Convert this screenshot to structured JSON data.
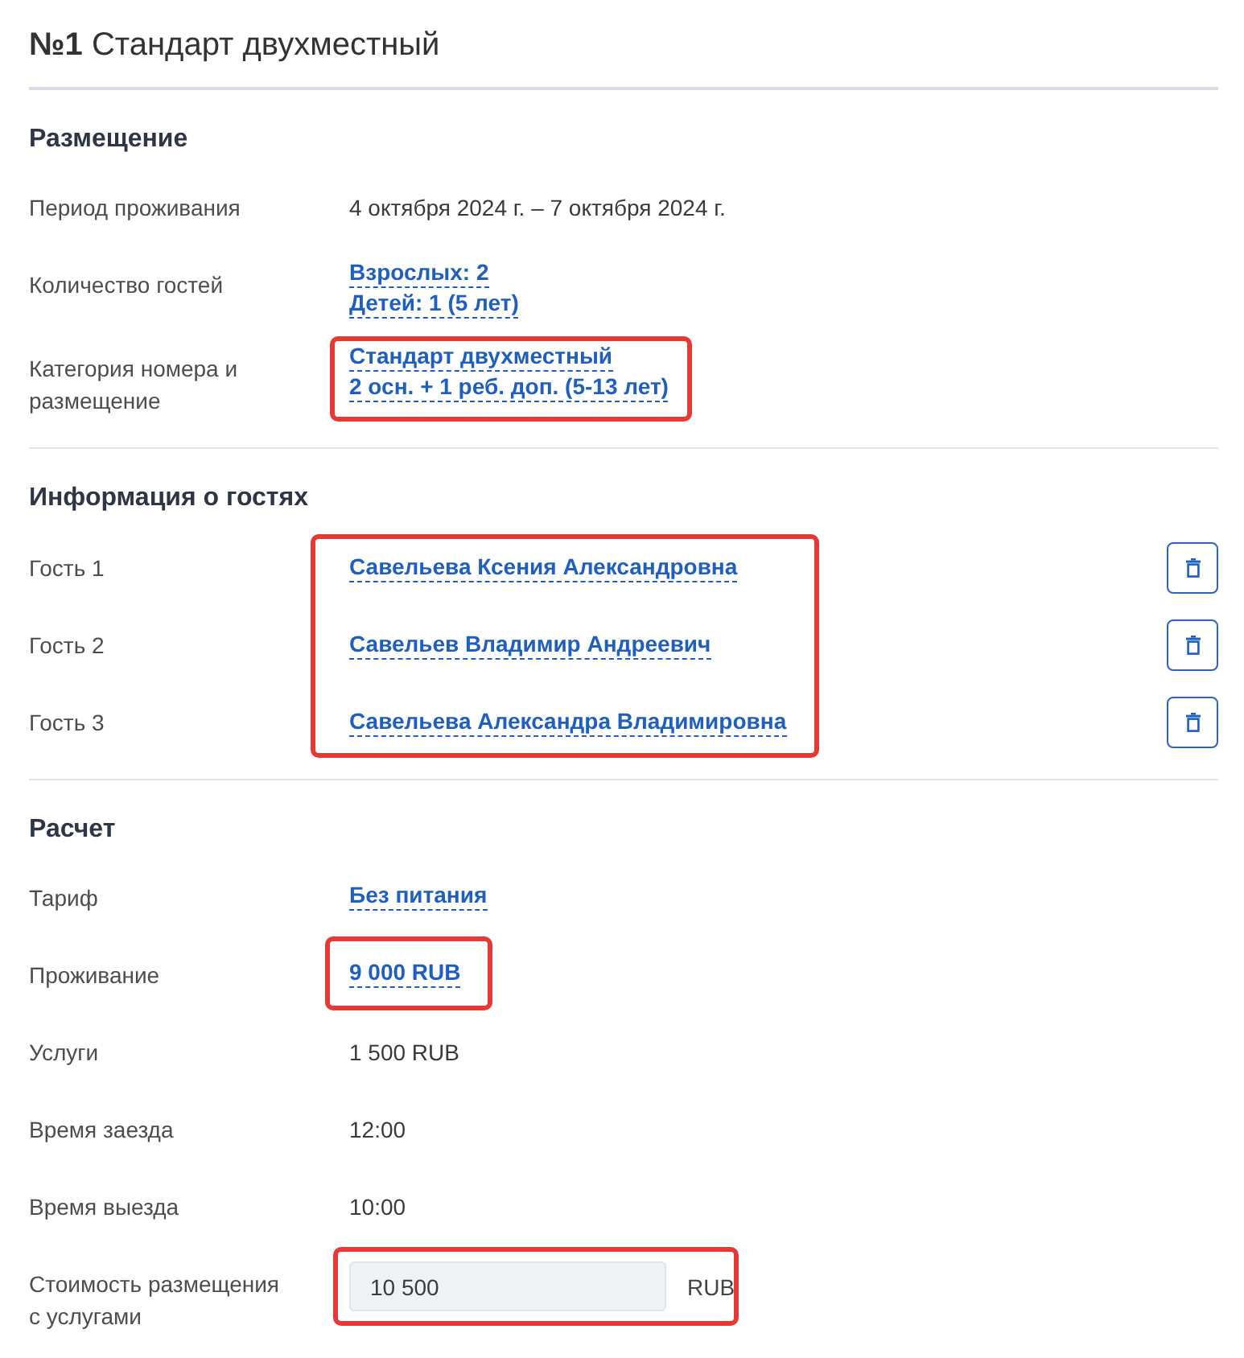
{
  "title": "**№1** Стандарт двухместный",
  "sections": [
    {
      "kind": "details",
      "heading": "Размещение",
      "rows": [
        {
          "kind": "text",
          "label": "Период проживания",
          "values": [
            "4 октября 2024 г. – 7 октября 2024 г."
          ],
          "highlighted": false
        },
        {
          "kind": "links",
          "label": "Количество гостей",
          "values": [
            "Взрослых: 2",
            "Детей: 1 (5 лет)"
          ],
          "highlighted": false
        },
        {
          "kind": "links",
          "label": "Категория номера и\nразмещение",
          "values": [
            "Стандарт двухместный",
            "2 осн. + 1 реб. доп. (5-13 лет)"
          ],
          "highlighted": true
        }
      ]
    },
    {
      "kind": "guests",
      "heading": "Информация о гостях",
      "highlighted": true,
      "guests": [
        {
          "label": "Гость 1",
          "name": "Савельева Ксения Александровна"
        },
        {
          "label": "Гость 2",
          "name": "Савельев Владимир Андреевич"
        },
        {
          "label": "Гость 3",
          "name": "Савельева Александра Владимировна"
        }
      ]
    },
    {
      "kind": "details",
      "heading": "Расчет",
      "rows": [
        {
          "kind": "links",
          "label": "Тариф",
          "values": [
            "Без питания"
          ],
          "highlighted": false
        },
        {
          "kind": "links",
          "label": "Проживание",
          "values": [
            "9 000 RUB"
          ],
          "highlighted": true
        },
        {
          "kind": "text",
          "label": "Услуги",
          "values": [
            "1 500 RUB"
          ],
          "highlighted": false
        },
        {
          "kind": "text",
          "label": "Время заезда",
          "values": [
            "12:00"
          ],
          "highlighted": false
        },
        {
          "kind": "text",
          "label": "Время выезда",
          "values": [
            "10:00"
          ],
          "highlighted": false
        },
        {
          "kind": "field",
          "label": "Стоимость размещения\nс услугами",
          "value": "10 500",
          "unit": "RUB",
          "disabled": true,
          "highlighted": true
        }
      ]
    }
  ]
}
